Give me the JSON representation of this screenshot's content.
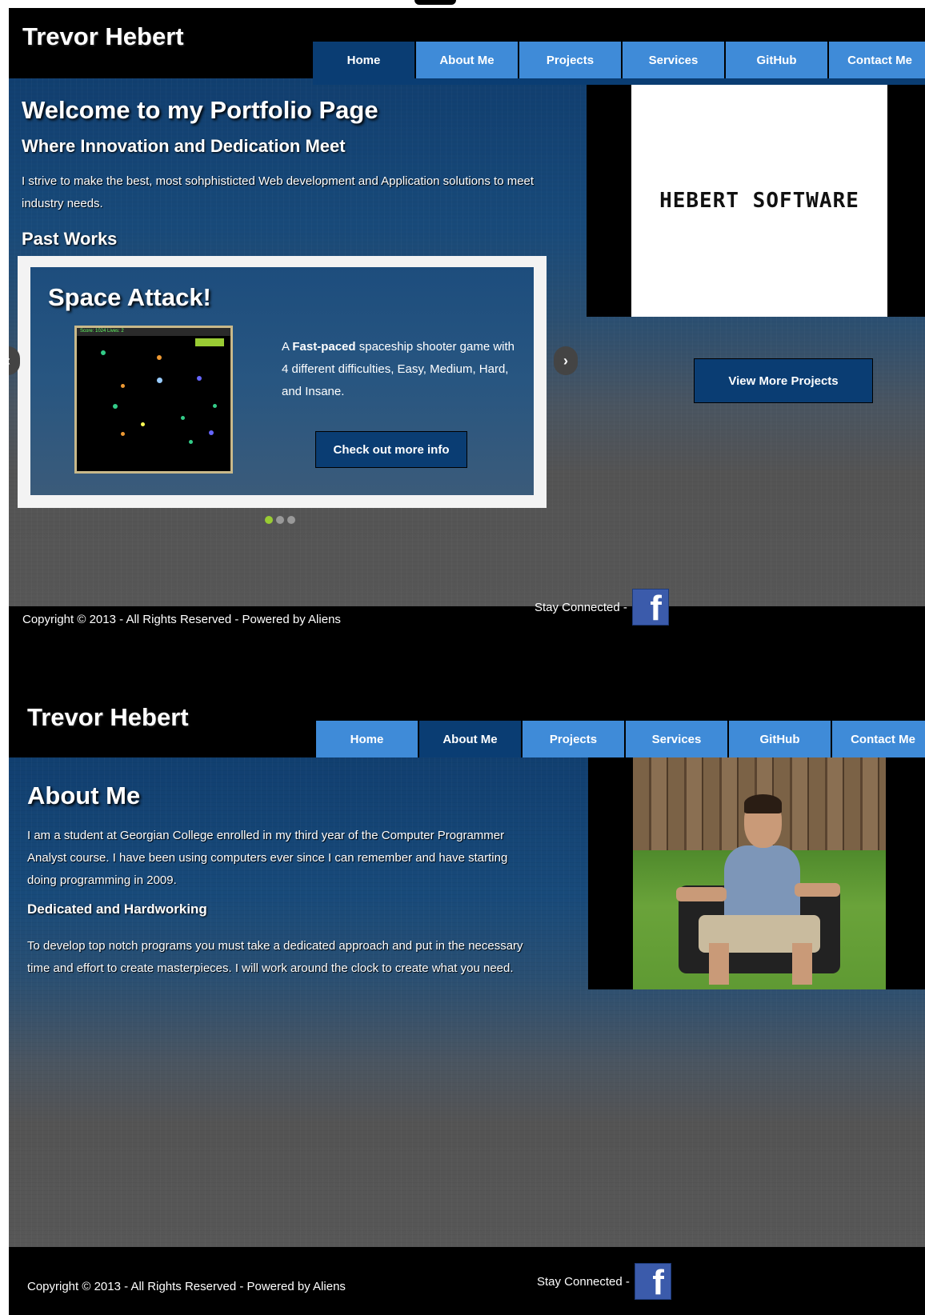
{
  "site": {
    "brand": "Trevor Hebert",
    "nav": [
      "Home",
      "About Me",
      "Projects",
      "Services",
      "GitHub",
      "Contact Me"
    ]
  },
  "home": {
    "active_tab": "Home",
    "title": "Welcome to my Portfolio Page",
    "subtitle": "Where Innovation and Dedication Meet",
    "intro": "I strive to make the best, most sohphisticted Web development and Application solutions to meet industry needs.",
    "past_works_heading": "Past Works",
    "logo_text": "HEBERT SOFTWARE",
    "carousel": {
      "slide_title": "Space Attack!",
      "desc_prefix": "A ",
      "desc_bold": "Fast-paced",
      "desc_rest": " spaceship shooter game with 4 different difficulties, Easy, Medium, Hard, and Insane.",
      "button": "Check out more info",
      "game_hud": "Score: 1024 Lives: 2",
      "prev_icon": "‹",
      "next_icon": "›",
      "indicator_count": 3,
      "active_index": 0
    },
    "view_more_button": "View More Projects"
  },
  "about": {
    "active_tab": "About Me",
    "title": "About Me",
    "para1": "I am a student at Georgian College enrolled in my third year of the Computer Programmer Analyst course. I have been using computers ever since I can remember and have starting doing programming in 2009.",
    "heading2": "Dedicated and Hardworking",
    "para2": "To develop top notch programs you must take a dedicated approach and put in the necessary time and effort to create masterpieces. I will work around the clock to create what you need."
  },
  "footer": {
    "copyright": "Copyright © 2013 - All Rights Reserved - Powered by Aliens",
    "stay_connected": "Stay Connected -",
    "facebook_glyph": "f"
  },
  "colors": {
    "nav_tab": "#3f8bd8",
    "nav_active": "#0a3d73",
    "button_dark": "#0a3d73",
    "indicator_active": "#99cc33"
  },
  "icons": [
    "chevron-left-icon",
    "chevron-right-icon",
    "facebook-icon"
  ]
}
